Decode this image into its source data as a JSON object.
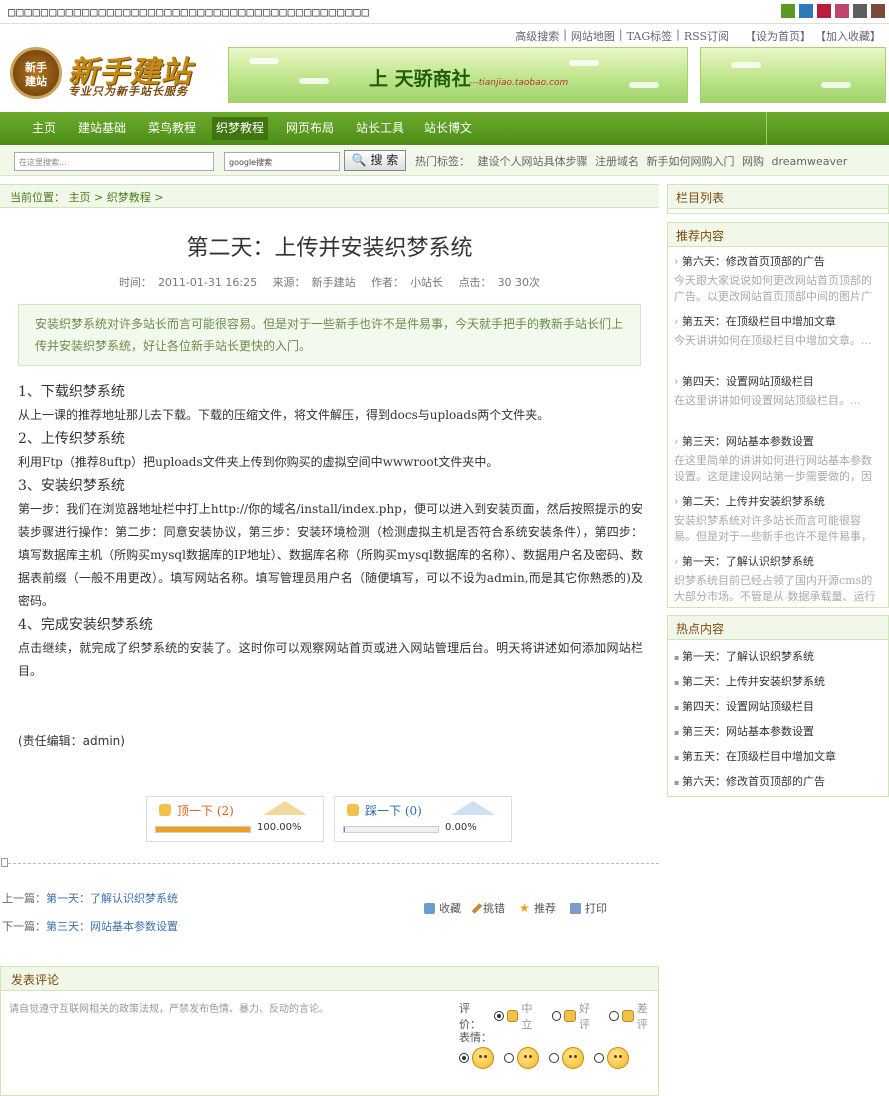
{
  "topbar": {
    "placeholder_text": "□□□□□□□□□□□□□□□□□□□□□□□□□□□□□□□□□□□□□□□□□□□□",
    "swatches": [
      "#5b9a22",
      "#2f7ab6",
      "#b81e3c",
      "#c0446e",
      "#5e5e5e",
      "#7a4a3a"
    ]
  },
  "toplinks": [
    "高级搜索",
    "|",
    "网站地图",
    "|",
    "TAG标签",
    "|",
    "RSS订阅",
    "【设为首页】",
    "【加入收藏】"
  ],
  "logo": {
    "badge_top": "新手",
    "badge_bottom": "建站",
    "name": "新手建站",
    "slogan": "专业只为新手站长服务"
  },
  "banner": {
    "text": "上 天骄商社",
    "url": "---tianjiao.taobao.com"
  },
  "nav": {
    "items": [
      "主页",
      "建站基础",
      "菜鸟教程",
      "织梦教程",
      "网页布局",
      "站长工具",
      "站长博文"
    ],
    "current": "织梦教程"
  },
  "search": {
    "site_placeholder": "在这里搜索...",
    "google_value": "google搜索",
    "button": "搜 索",
    "hot_label": "热门标签：",
    "hot_tags": [
      "建设个人网站具体步骤",
      "注册域名",
      "新手如何网购入门",
      "网购",
      "dreamweaver"
    ]
  },
  "breadcrumb": {
    "label": "当前位置：",
    "home": "主页",
    "sep": ">",
    "section": "织梦教程",
    "tail": ">"
  },
  "article": {
    "title": "第二天：上传并安装织梦系统",
    "meta": {
      "time_label": "时间：",
      "time": "2011-01-31 16:25",
      "source_label": "来源：",
      "source": "新手建站",
      "author_label": "作者：",
      "author": "小站长",
      "clicks_label": "点击：",
      "clicks": "30 30次"
    },
    "summary": "安装织梦系统对许多站长而言可能很容易。但是对于一些新手也许不是件易事，今天就手把手的教新手站长们上传并安装织梦系统，好让各位新手站长更快的入门。",
    "sections": [
      {
        "heading": "1、下载织梦系统",
        "text": "从上一课的推荐地址那儿去下载。下载的压缩文件，将文件解压，得到docs与uploads两个文件夹。"
      },
      {
        "heading": "2、上传织梦系统",
        "text": "利用Ftp（推荐8uftp）把uploads文件夹上传到你购买的虚拟空间中wwwroot文件夹中。"
      },
      {
        "heading": "3、安装织梦系统",
        "text": "第一步：我们在浏览器地址栏中打上http://你的域名/install/index.php，便可以进入到安装页面，然后按照提示的安装步骤进行操作：第二步：同意安装协议，第三步：安装环境检测（检测虚拟主机是否符合系统安装条件），第四步：填写数据库主机（所购买mysql数据库的IP地址）、数据库名称（所购买mysql数据库的名称）、数据用户名及密码、数据表前缀（一般不用更改）。填写网站名称。填写管理员用户名（随便填写，可以不设为admin,而是其它你熟悉的)及密码。"
      },
      {
        "heading": "4、完成安装织梦系统",
        "text": "点击继续，就完成了织梦系统的安装了。这时你可以观察网站首页或进入网站管理后台。明天将讲述如何添加网站栏目。"
      }
    ],
    "editor": "(责任编辑：admin)"
  },
  "votes": {
    "up": {
      "label": "顶一下",
      "count": "(2)",
      "pct": "100.00%",
      "fraction": 1.0,
      "color": "#f0a020"
    },
    "down": {
      "label": "踩一下",
      "count": "(0)",
      "pct": "0.00%",
      "fraction": 0.0,
      "color": "#4a8fd0"
    }
  },
  "prevnext": {
    "prev_label": "上一篇：",
    "prev": "第一天：了解认识织梦系统",
    "next_label": "下一篇：",
    "next": "第三天：网站基本参数设置"
  },
  "actions": [
    "收藏",
    "挑错",
    "推荐",
    "打印"
  ],
  "comment": {
    "title": "发表评论",
    "notice": "请自觉遵守互联网相关的政策法规，严禁发布色情、暴力、反动的言论。",
    "rating_label": "评价：",
    "ratings": [
      "中立",
      "好评",
      "差评"
    ],
    "face_label": "表情："
  },
  "sidebar": {
    "column_title": "栏目列表",
    "recommend_title": "推荐内容",
    "recommend": [
      {
        "title": "第六天：修改首页顶部的广告",
        "desc": "今天跟大家说说如何更改网站首页顶部的广告。以更改网站首页顶部中间的图片广"
      },
      {
        "title": "第五天：在顶级栏目中增加文章",
        "desc": "今天讲讲如何在顶级栏目中增加文章。..."
      },
      {
        "title": "第四天：设置网站顶级栏目",
        "desc": "在这里讲讲如何设置网站顶级栏目。..."
      },
      {
        "title": "第三天：网站基本参数设置",
        "desc": "在这里简单的讲讲如何进行网站基本参数设置。这是建设网站第一步需要做的，因"
      },
      {
        "title": "第二天：上传并安装织梦系统",
        "desc": "安装织梦系统对许多站长而言可能很容易。但是对于一些新手也许不是件易事，"
      },
      {
        "title": "第一天：了解认识织梦系统",
        "desc": "织梦系统目前已经占领了国内开源cms的大部分市场。不管是从 数据承载量、运行"
      }
    ],
    "hot_title": "热点内容",
    "hot": [
      "第一天：了解认识织梦系统",
      "第二天：上传并安装织梦系统",
      "第四天：设置网站顶级栏目",
      "第三天：网站基本参数设置",
      "第五天：在顶级栏目中增加文章",
      "第六天：修改首页顶部的广告"
    ]
  }
}
